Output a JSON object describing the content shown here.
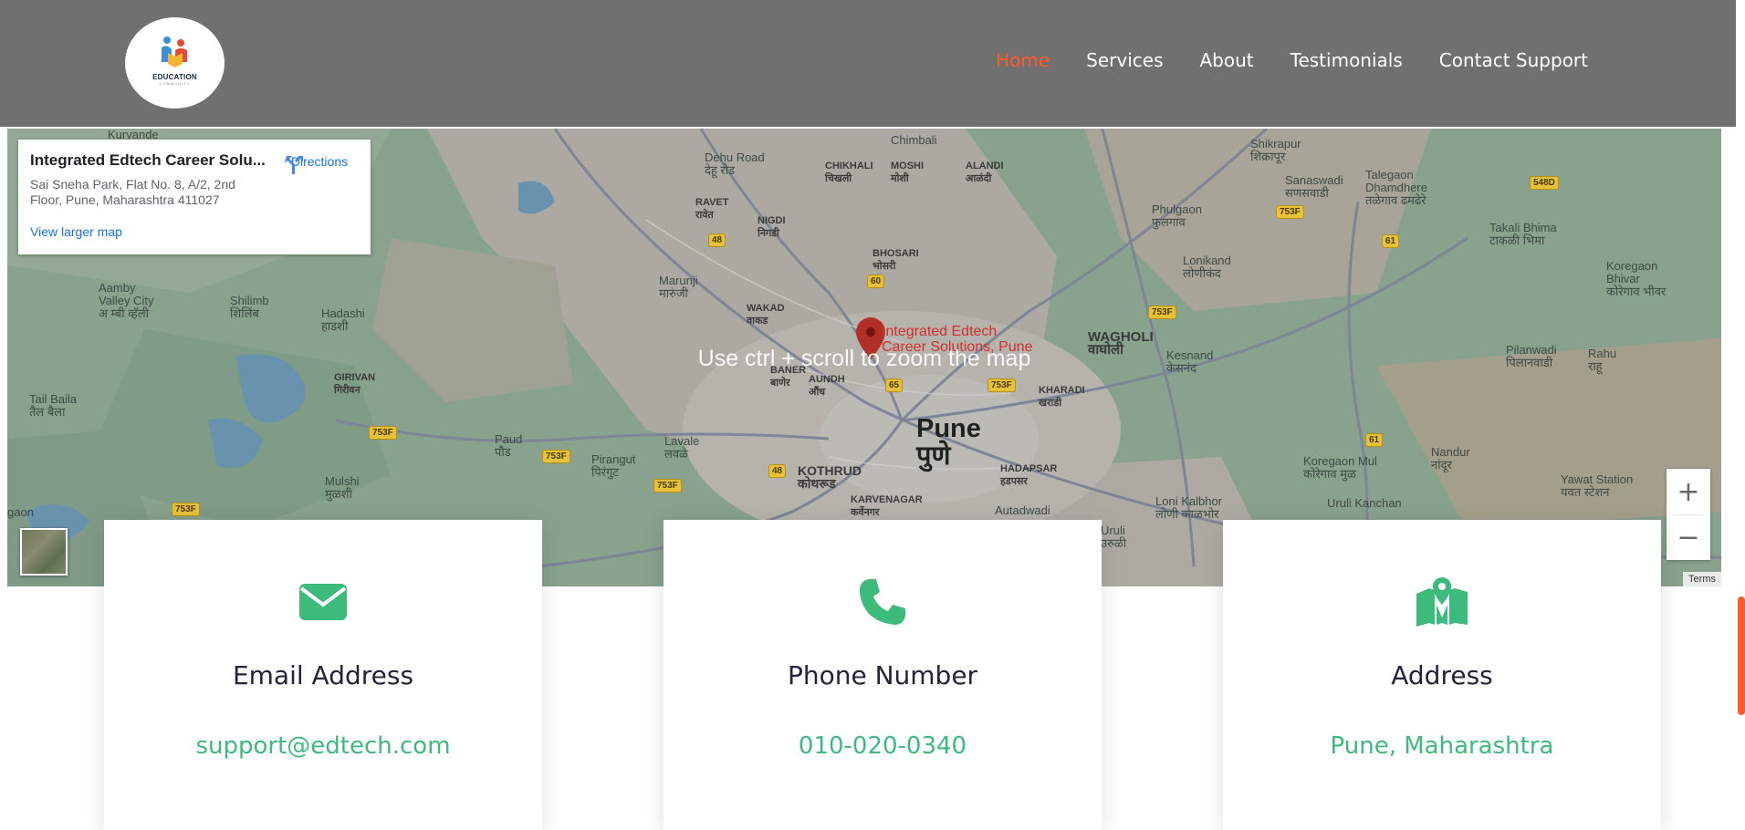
{
  "header": {
    "logo": {
      "text": "EDUCATION",
      "sub": "COMMUNITY"
    },
    "nav": [
      {
        "label": "Home",
        "active": true
      },
      {
        "label": "Services",
        "active": false
      },
      {
        "label": "About",
        "active": false
      },
      {
        "label": "Testimonials",
        "active": false
      },
      {
        "label": "Contact Support",
        "active": false
      }
    ]
  },
  "map": {
    "overlay_text": "Use ctrl + scroll to zoom the map",
    "info": {
      "title": "Integrated Edtech Career Solu...",
      "address": "Sai Sneha Park, Flat No. 8, A/2, 2nd Floor, Pune, Maharashtra 411027",
      "larger_map_link": "View larger map",
      "directions_label": "Directions"
    },
    "poi_label_1": "Integrated Edtech",
    "poi_label_2": "Career Solutions, Pune",
    "terms": "Terms",
    "labels": {
      "dehu_road": "Dehu Road",
      "dehu_road_mr": "देहू रोड",
      "chimbali": "Chimbali",
      "chikhali": "CHIKHALI",
      "chikhali_mr": "चिखली",
      "moshi": "MOSHI",
      "moshi_mr": "मोशी",
      "alandi": "ALANDI",
      "alandi_mr": "आळंदी",
      "shikrapur": "Shikrapur",
      "shikrapur_mr": "शिक्रापूर",
      "sanaswadi": "Sanaswadi",
      "sanaswadi_mr": "सणसवाडी",
      "talegaon": "Talegaon",
      "talegaon2": "Dhamdhere",
      "talegaon_mr": "तळेगाव ढमढेरे",
      "ravet": "RAVET",
      "ravet_mr": "रावेत",
      "nigdi": "NIGDI",
      "nigdi_mr": "निगडी",
      "phulgaon": "Phulgaon",
      "phulgaon_mr": "फुलगाव",
      "takali": "Takali Bhima",
      "takali_mr": "टाकळी भिमा",
      "koregaon_bhivar": "Koregaon",
      "koregaon_bhivar2": "Bhivar",
      "koregaon_bhivar_mr": "कोरेगाव भीवर",
      "bhosari": "BHOSARI",
      "bhosari_mr": "भोसरी",
      "lonikand": "Lonikand",
      "lonikand_mr": "लोणीकंद",
      "aamby": "Aamby",
      "aamby2": "Valley City",
      "aamby_mr": "अ म्बी व्हॅली",
      "shilimb": "Shilimb",
      "shilimb_mr": "शिलिंब",
      "hadashi": "Hadashi",
      "hadashi_mr": "हाडशी",
      "marunji": "Marunji",
      "marunji_mr": "मारुंजी",
      "wakad": "WAKAD",
      "wakad_mr": "वाकड",
      "wagholi": "WAGHOLI",
      "wagholi_mr": "वाघोली",
      "kesnand": "Kesnand",
      "kesnand_mr": "केसनंद",
      "pilanwadi": "Pilanwadi",
      "pilanwadi_mr": "पिलानवाडी",
      "rahu": "Rahu",
      "rahu_mr": "राहू",
      "girivan": "GIRIVAN",
      "girivan_mr": "गिरीवन",
      "baner": "BANER",
      "baner_mr": "बाणेर",
      "aundh": "AUNDH",
      "aundh_mr": "औंध",
      "kharadi": "KHARADI",
      "kharadi_mr": "खराडी",
      "tail_baila": "Tail Baila",
      "tail_baila_mr": "तैल बैला",
      "paud": "Paud",
      "paud_mr": "पौड",
      "pune": "Pune",
      "pune_mr": "पुणे",
      "lavale": "Lavale",
      "lavale_mr": "लवळे",
      "pirangut": "Pirangut",
      "pirangut_mr": "पिरंगुट",
      "kothrud": "KOTHRUD",
      "kothrud_mr": "कोथरूड",
      "hadapsar": "HADAPSAR",
      "hadapsar_mr": "हडपसर",
      "koregaon_mul": "Koregaon Mul",
      "koregaon_mul_mr": "कोरेगाव मुळ",
      "nandur": "Nandur",
      "nandur_mr": "नांदूर",
      "yawat": "Yawat Station",
      "yawat_mr": "यवत स्टेशन",
      "mulshi": "Mulshi",
      "mulshi_mr": "मुळशी",
      "karvenagar": "KARVENAGAR",
      "karvenagar_mr": "कर्वेनगर",
      "loni_kalbhor": "Loni Kalbhor",
      "loni_kalbhor_mr": "लोणी काळभोर",
      "uruli": "Uruli Kanchan",
      "autadwadi": "Autadwadi",
      "uruli_devachi": "Uruli",
      "uruli_devachi_mr": "उरुळी",
      "kurvande": "Kurvande",
      "gaon": "gaon"
    },
    "shields": [
      "48",
      "60",
      "65",
      "753F",
      "753F",
      "753F",
      "753F",
      "753F",
      "753F",
      "753F",
      "548D",
      "61",
      "61",
      "48"
    ]
  },
  "cards": [
    {
      "icon": "envelope-icon",
      "title": "Email Address",
      "value": "support@edtech.com"
    },
    {
      "icon": "phone-icon",
      "title": "Phone Number",
      "value": "010-020-0340"
    },
    {
      "icon": "map-marker-icon",
      "title": "Address",
      "value": "Pune, Maharashtra"
    }
  ],
  "colors": {
    "accent": "#3dbb7c",
    "nav_active": "#ff5a2c",
    "header_bg": "#707070"
  }
}
